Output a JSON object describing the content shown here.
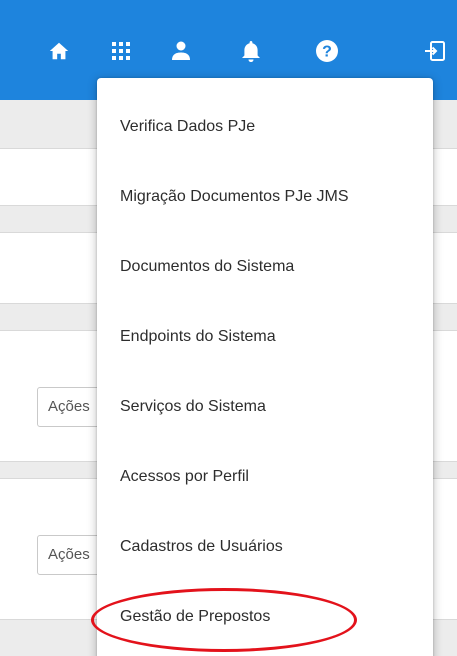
{
  "topbar": {
    "color": "#1e84dd",
    "icons": [
      "home-icon",
      "apps-grid-icon",
      "user-icon",
      "bell-icon",
      "help-icon",
      "logout-icon"
    ]
  },
  "background": {
    "action_select_1": "Ações",
    "action_select_2": "Ações"
  },
  "menu": {
    "items": [
      {
        "label": "Verifica Dados PJe"
      },
      {
        "label": "Migração Documentos PJe JMS"
      },
      {
        "label": "Documentos do Sistema"
      },
      {
        "label": "Endpoints do Sistema"
      },
      {
        "label": "Serviços do Sistema"
      },
      {
        "label": "Acessos por Perfil"
      },
      {
        "label": "Cadastros de Usuários"
      },
      {
        "label": "Gestão de Prepostos"
      }
    ]
  },
  "annotation": {
    "highlight_color": "#e3121b"
  }
}
